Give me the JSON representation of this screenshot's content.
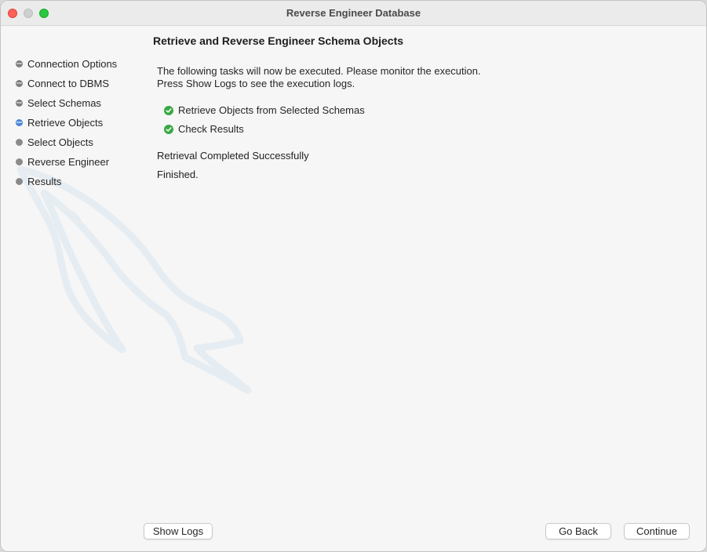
{
  "window": {
    "title": "Reverse Engineer Database"
  },
  "sidebar": {
    "steps": [
      {
        "label": "Connection Options",
        "state": "done"
      },
      {
        "label": "Connect to DBMS",
        "state": "done"
      },
      {
        "label": "Select Schemas",
        "state": "done"
      },
      {
        "label": "Retrieve Objects",
        "state": "current"
      },
      {
        "label": "Select Objects",
        "state": "pending"
      },
      {
        "label": "Reverse Engineer",
        "state": "pending"
      },
      {
        "label": "Results",
        "state": "pending"
      }
    ]
  },
  "main": {
    "heading": "Retrieve and Reverse Engineer Schema Objects",
    "description_line1": "The following tasks will now be executed. Please monitor the execution.",
    "description_line2": "Press Show Logs to see the execution logs.",
    "tasks": [
      {
        "label": "Retrieve Objects from Selected Schemas",
        "status": "completed"
      },
      {
        "label": "Check Results",
        "status": "completed"
      }
    ],
    "status_message": "Retrieval Completed Successfully",
    "status_detail": "Finished."
  },
  "footer": {
    "show_logs_label": "Show Logs",
    "go_back_label": "Go Back",
    "continue_label": "Continue"
  },
  "colors": {
    "close": "#fe5f57",
    "maximize": "#28c840",
    "check": "#3aa845",
    "current_step": "#4a86d4"
  }
}
